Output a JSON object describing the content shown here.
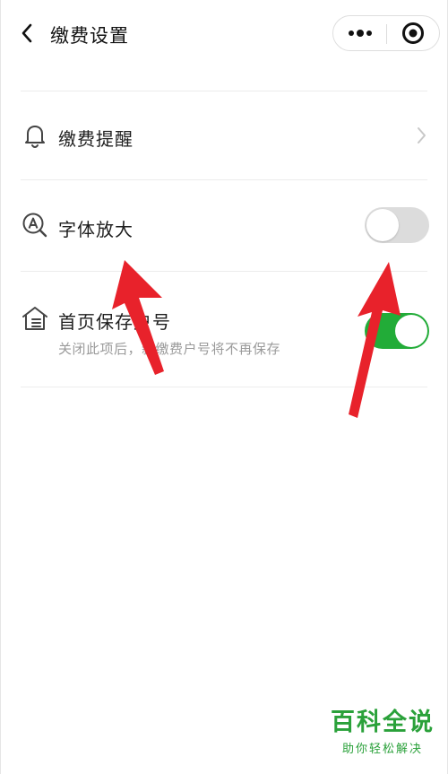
{
  "nav": {
    "title": "缴费设置",
    "back_icon": "chevron-left-icon",
    "more_icon": "more-dots-icon",
    "close_icon": "target-circle-icon"
  },
  "settings": [
    {
      "id": "payment-reminder",
      "icon": "bell-icon",
      "label": "缴费提醒",
      "control": "chevron-right-icon"
    },
    {
      "id": "font-enlarge",
      "icon": "font-magnify-icon",
      "label": "字体放大",
      "control": "switch",
      "enabled": false
    },
    {
      "id": "save-account-home",
      "icon": "house-list-icon",
      "label": "首页保存户号",
      "subtext": "关闭此项后，新缴费户号将不再保存",
      "control": "switch",
      "enabled": true
    }
  ],
  "colors": {
    "switch_on": "#22ac38",
    "switch_off": "#dcdcdc",
    "annotation_arrow": "#e8222b",
    "watermark": "#2aa13a"
  },
  "watermark": {
    "title": "百科全说",
    "subtitle": "助你轻松解决"
  }
}
